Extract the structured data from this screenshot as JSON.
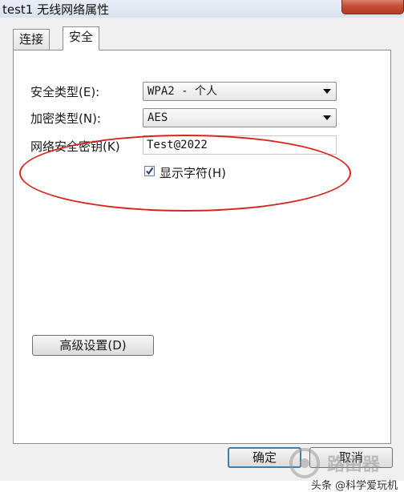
{
  "window": {
    "title": "test1 无线网络属性"
  },
  "tabs": [
    {
      "label": "连接",
      "active": false
    },
    {
      "label": "安全",
      "active": true
    }
  ],
  "security": {
    "type_label": "安全类型(E):",
    "type_value": "WPA2 - 个人",
    "encryption_label": "加密类型(N):",
    "encryption_value": "AES",
    "key_label": "网络安全密钥(K)",
    "key_value": "Test@2022",
    "show_chars_label": "显示字符(H)",
    "show_chars_checked": true
  },
  "buttons": {
    "advanced": "高级设置(D)",
    "ok": "确定",
    "cancel": "取消"
  },
  "watermark": {
    "logo_text": "路由器",
    "credit": "头条 @科学爱玩机"
  },
  "annotation": {
    "oval_color": "#d7261e"
  }
}
